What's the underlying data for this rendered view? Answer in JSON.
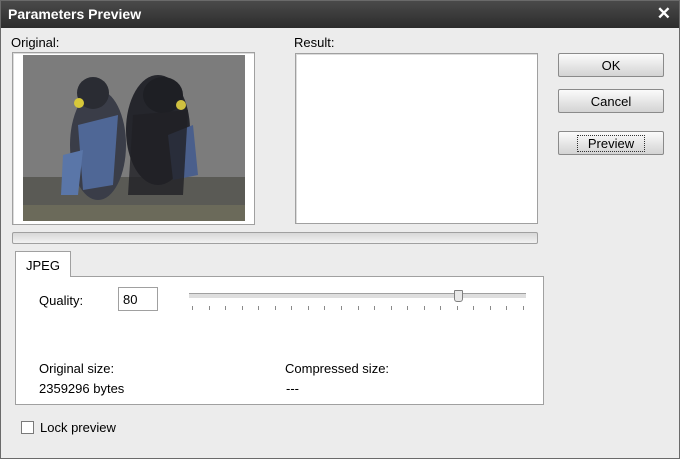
{
  "window": {
    "title": "Parameters Preview"
  },
  "labels": {
    "original": "Original:",
    "result": "Result:"
  },
  "buttons": {
    "ok": "OK",
    "cancel": "Cancel",
    "preview": "Preview"
  },
  "tab": {
    "label": "JPEG"
  },
  "quality": {
    "label": "Quality:",
    "value": "80",
    "slider_fraction": 0.8
  },
  "sizes": {
    "original_label": "Original size:",
    "original_value": "2359296 bytes",
    "compressed_label": "Compressed size:",
    "compressed_value": "---"
  },
  "lock_preview": {
    "label": "Lock preview",
    "checked": false
  },
  "icons": {
    "close": "close-icon"
  }
}
